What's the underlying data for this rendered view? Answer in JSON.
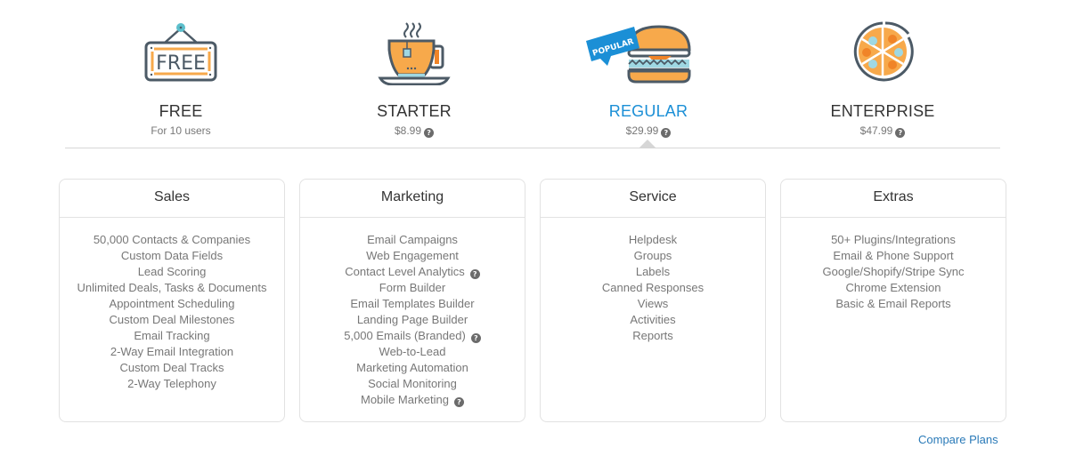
{
  "plans": [
    {
      "id": "free",
      "name": "FREE",
      "price": "For 10 users",
      "icon": "free-sign-icon",
      "has_help": false
    },
    {
      "id": "starter",
      "name": "STARTER",
      "price": "$8.99",
      "icon": "tea-cup-icon",
      "has_help": true
    },
    {
      "id": "regular",
      "name": "REGULAR",
      "price": "$29.99",
      "icon": "burger-icon",
      "has_help": true,
      "badge": "POPULAR",
      "selected": true
    },
    {
      "id": "enterprise",
      "name": "ENTERPRISE",
      "price": "$47.99",
      "icon": "pizza-icon",
      "has_help": true
    }
  ],
  "free_sign_text": "FREE",
  "colors": {
    "accent": "#1b8fd6",
    "orange": "#f7a94b",
    "dark_orange": "#f08428",
    "outline": "#4c5a66",
    "light_blue": "#9fd8e3",
    "link": "#2a7ab8"
  },
  "cards": [
    {
      "title": "Sales",
      "items": [
        {
          "label": "50,000 Contacts & Companies"
        },
        {
          "label": "Custom Data Fields"
        },
        {
          "label": "Lead Scoring"
        },
        {
          "label": "Unlimited Deals, Tasks & Documents"
        },
        {
          "label": "Appointment Scheduling"
        },
        {
          "label": "Custom Deal Milestones"
        },
        {
          "label": "Email Tracking"
        },
        {
          "label": "2-Way Email Integration"
        },
        {
          "label": "Custom Deal Tracks"
        },
        {
          "label": "2-Way Telephony"
        }
      ]
    },
    {
      "title": "Marketing",
      "items": [
        {
          "label": "Email Campaigns"
        },
        {
          "label": "Web Engagement"
        },
        {
          "label": "Contact Level Analytics",
          "help": true
        },
        {
          "label": "Form Builder"
        },
        {
          "label": "Email Templates Builder"
        },
        {
          "label": "Landing Page Builder"
        },
        {
          "label": "5,000 Emails (Branded)",
          "help": true
        },
        {
          "label": "Web-to-Lead"
        },
        {
          "label": "Marketing Automation"
        },
        {
          "label": "Social Monitoring"
        },
        {
          "label": "Mobile Marketing",
          "help": true
        }
      ]
    },
    {
      "title": "Service",
      "items": [
        {
          "label": "Helpdesk"
        },
        {
          "label": "Groups"
        },
        {
          "label": "Labels"
        },
        {
          "label": "Canned Responses"
        },
        {
          "label": "Views"
        },
        {
          "label": "Activities"
        },
        {
          "label": "Reports"
        }
      ]
    },
    {
      "title": "Extras",
      "items": [
        {
          "label": "50+ Plugins/Integrations"
        },
        {
          "label": "Email & Phone Support"
        },
        {
          "label": "Google/Shopify/Stripe Sync"
        },
        {
          "label": "Chrome Extension"
        },
        {
          "label": "Basic & Email Reports"
        }
      ]
    }
  ],
  "help_glyph": "?",
  "compare_link": "Compare Plans"
}
